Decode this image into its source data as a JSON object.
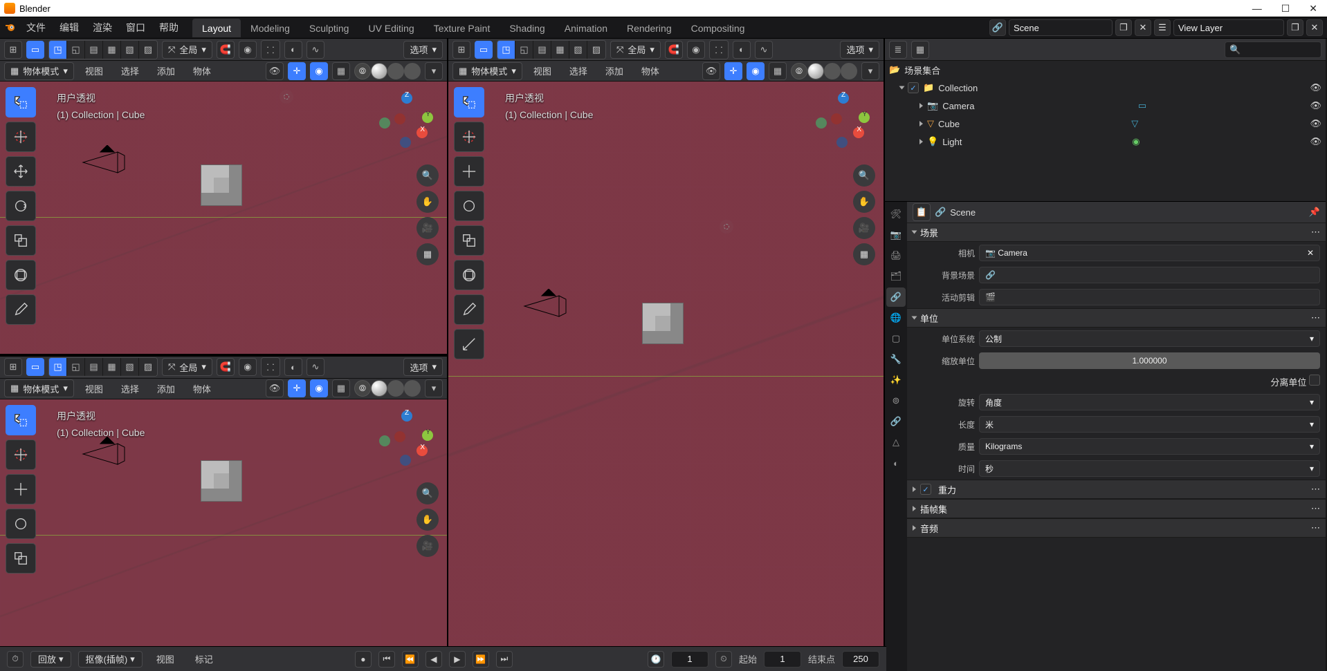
{
  "app": {
    "title": "Blender"
  },
  "menus": [
    "文件",
    "编辑",
    "渲染",
    "窗口",
    "帮助"
  ],
  "workspaces": [
    "Layout",
    "Modeling",
    "Sculpting",
    "UV Editing",
    "Texture Paint",
    "Shading",
    "Animation",
    "Rendering",
    "Compositing"
  ],
  "activeWorkspace": "Layout",
  "scene_name": "Scene",
  "view_layer_name": "View Layer",
  "viewport": {
    "mode_label": "物体模式",
    "orientation_label": "全局",
    "options_label": "选项",
    "menu": {
      "view": "视图",
      "select": "选择",
      "add": "添加",
      "object": "物体"
    },
    "overlay": {
      "line1": "用户透视",
      "line2": "(1) Collection | Cube"
    }
  },
  "outliner": {
    "root": "场景集合",
    "collection": "Collection",
    "items": [
      "Camera",
      "Cube",
      "Light"
    ]
  },
  "props": {
    "scene_label": "Scene",
    "panels": {
      "scene": "场景",
      "units": "单位",
      "gravity": "重力",
      "keysets": "插帧集",
      "audio": "音频"
    },
    "scene_fields": {
      "camera": {
        "label": "相机",
        "value": "Camera"
      },
      "bg_scene": {
        "label": "背景场景",
        "value": ""
      },
      "active_clip": {
        "label": "活动剪辑",
        "value": ""
      }
    },
    "units": {
      "system": {
        "label": "单位系统",
        "value": "公制"
      },
      "scale": {
        "label": "缩放单位",
        "value": "1.000000"
      },
      "separate": {
        "label": "分离单位"
      },
      "rotation": {
        "label": "旋转",
        "value": "角度"
      },
      "length": {
        "label": "长度",
        "value": "米"
      },
      "mass": {
        "label": "质量",
        "value": "Kilograms"
      },
      "time": {
        "label": "时间",
        "value": "秒"
      }
    }
  },
  "timeline": {
    "playback": "回放",
    "keying": "抠像(插帧)",
    "view": "视图",
    "marker": "标记",
    "current": "1",
    "start_label": "起始",
    "start": "1",
    "end_label": "结束点",
    "end": "250"
  }
}
